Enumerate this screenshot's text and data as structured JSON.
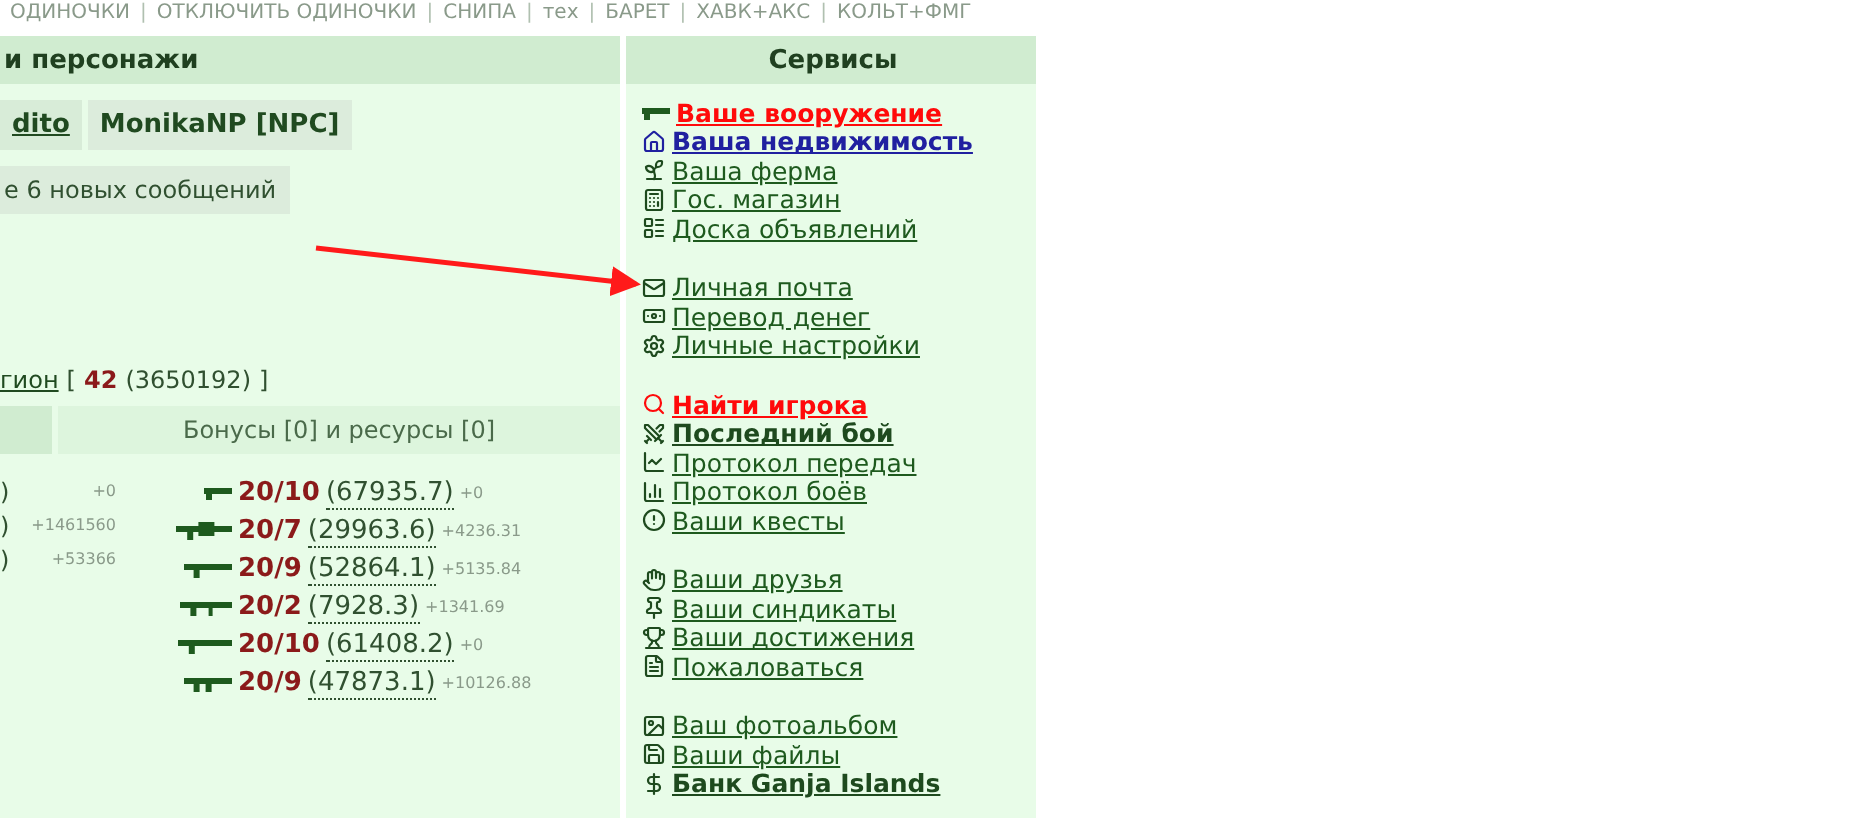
{
  "top_links": {
    "separator": "|",
    "items": [
      "ОДИНОЧКИ",
      "ОТКЛЮЧИТЬ ОДИНОЧКИ",
      "СНИПА",
      "тех",
      "БАРЕТ",
      "ХАВК+АКС",
      "КОЛЬТ+ФМГ"
    ]
  },
  "characters_panel": {
    "title": "и персонажи",
    "characters": [
      {
        "name": "dito",
        "selected": true
      },
      {
        "name": "MonikaNP [NPC]",
        "selected": false
      }
    ],
    "messages": "е 6 новых сообщений",
    "syndicate": {
      "link": "гион",
      "open": "[",
      "level": "42",
      "points": "(3650192)",
      "close": "]"
    },
    "stats_header": {
      "column_2": "Бонусы [0] и ресурсы [0]"
    },
    "stats": [
      {
        "value": ")",
        "delta": "+0"
      },
      {
        "value": ")",
        "delta": "+1461560"
      },
      {
        "value": ")",
        "delta": "+53366"
      }
    ],
    "weapons": [
      {
        "kind": "pistol",
        "skill": "20/10",
        "points": "(67935.7)",
        "delta": "+0"
      },
      {
        "kind": "launcher",
        "skill": "20/7",
        "points": "(29963.6)",
        "delta": "+4236.31"
      },
      {
        "kind": "rifle",
        "skill": "20/9",
        "points": "(52864.1)",
        "delta": "+5135.84"
      },
      {
        "kind": "machinegun",
        "skill": "20/2",
        "points": "(7928.3)",
        "delta": "+1341.69"
      },
      {
        "kind": "shotgun",
        "skill": "20/10",
        "points": "(61408.2)",
        "delta": "+0"
      },
      {
        "kind": "assault",
        "skill": "20/9",
        "points": "(47873.1)",
        "delta": "+10126.88"
      }
    ]
  },
  "services": {
    "title": "Сервисы",
    "groups": [
      [
        "Ваше вооружение",
        "Ваша недвижимость",
        "Ваша ферма",
        "Гос. магазин",
        "Доска объявлений"
      ],
      [
        "Личная почта",
        "Перевод денег",
        "Личные настройки"
      ],
      [
        "Найти игрока",
        "Последний бой",
        "Протокол передач",
        "Протокол боёв",
        "Ваши квесты"
      ],
      [
        "Ваши друзья",
        "Ваши синдикаты",
        "Ваши достижения",
        "Пожаловаться"
      ],
      [
        "Ваш фотоальбом",
        "Ваши файлы",
        "Банк Ganja Islands"
      ]
    ]
  }
}
